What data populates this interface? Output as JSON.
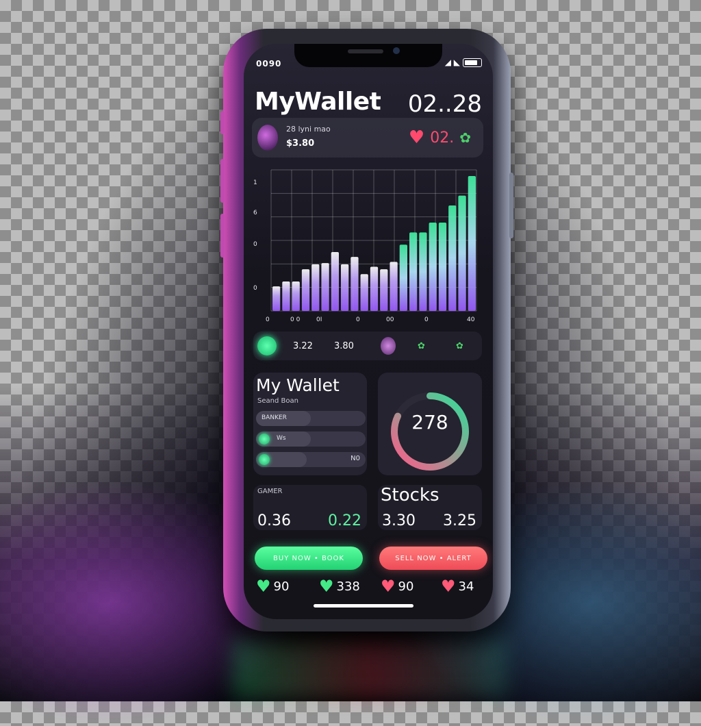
{
  "status_bar": {
    "left": "0090",
    "right_glyph": "◢ ◣"
  },
  "header": {
    "title": "MyWallet",
    "balance": "02..28"
  },
  "user_card": {
    "name": "28 lyni mao",
    "amount": "$3.80",
    "likes": "02.",
    "heart_icon": "heart-icon",
    "leaf_icon": "leaf-icon"
  },
  "chart_data": {
    "type": "bar",
    "y_tick_labels": [
      "1",
      "6",
      "0",
      "0"
    ],
    "x_tick_labels": [
      "0",
      "0 0",
      "0I",
      "0",
      "00",
      "0",
      "40"
    ],
    "values": [
      20,
      24,
      24,
      34,
      38,
      39,
      48,
      38,
      44,
      30,
      36,
      34,
      40,
      54,
      64,
      64,
      72,
      72,
      86,
      94,
      110
    ],
    "colors": {
      "start": "#9b5cff",
      "mid": "#c3a6ff",
      "end": "#3ff0a0"
    },
    "grid": true
  },
  "icon_row": {
    "items": [
      "3.22",
      "3.80",
      "",
      "",
      ""
    ]
  },
  "wallet_card": {
    "title": "My Wallet",
    "subtitle": "Seand Boan",
    "rows": [
      {
        "label": "BANKER",
        "value": "",
        "fill": 0.5
      },
      {
        "label": "Ws",
        "value": "",
        "fill": 0.5
      },
      {
        "label": "",
        "value": "N0",
        "fill": 0.46
      }
    ]
  },
  "gauge": {
    "value": "278",
    "fraction": 0.82,
    "colors": {
      "a": "#ff5a8a",
      "b": "#2fe09a"
    }
  },
  "stat_left": {
    "label": "GAMER",
    "a": "0.36",
    "b": "0.22",
    "b_color": "#5ff3a3"
  },
  "stat_right": {
    "title": "Stocks",
    "a": "3.30",
    "b": "3.25"
  },
  "cta": {
    "buy": "BUY NOW • BOOK",
    "sell": "SELL NOW • ALERT"
  },
  "reactions": [
    {
      "value": "90",
      "color": "#43ea86"
    },
    {
      "value": "338",
      "color": "#43ea86"
    },
    {
      "value": "90",
      "color": "#ff5a78"
    },
    {
      "value": "34",
      "color": "#ff5a78"
    }
  ]
}
